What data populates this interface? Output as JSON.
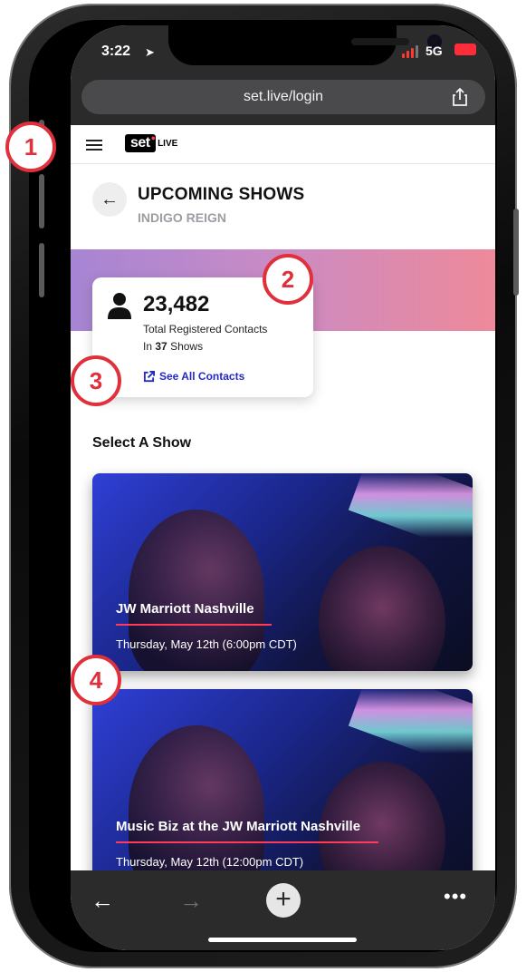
{
  "status_bar": {
    "time": "3:22",
    "network": "5G"
  },
  "browser": {
    "url": "set.live/login"
  },
  "app": {
    "logo_text": "set",
    "logo_suffix": "LIVE"
  },
  "page": {
    "title": "UPCOMING SHOWS",
    "artist": "INDIGO REIGN"
  },
  "stats": {
    "count": "23,482",
    "label": "Total Registered Contacts",
    "shows_prefix": "In",
    "shows_count": "37",
    "shows_suffix": "Shows",
    "see_all_label": "See All Contacts"
  },
  "section_title": "Select A Show",
  "shows": [
    {
      "venue": "JW Marriott Nashville",
      "date": "Thursday, May 12th (6:00pm CDT)"
    },
    {
      "venue": "Music Biz at the JW Marriott Nashville",
      "date": "Thursday, May 12th (12:00pm CDT)"
    }
  ],
  "callouts": [
    "1",
    "2",
    "3",
    "4"
  ],
  "colors": {
    "accent_blue": "#2329c8",
    "callout_red": "#e0303c",
    "banner_start": "#a685d4",
    "banner_end": "#ee8a9a"
  }
}
